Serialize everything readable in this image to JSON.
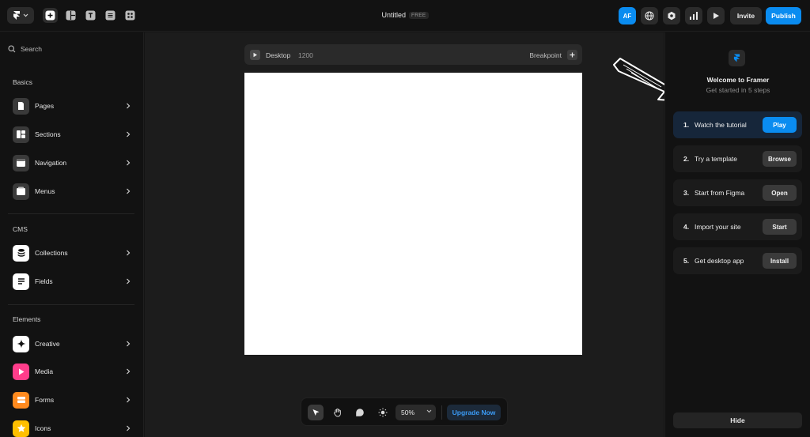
{
  "topbar": {
    "title": "Untitled",
    "plan_badge": "FREE",
    "avatar_initials": "AF",
    "invite_label": "Invite",
    "publish_label": "Publish"
  },
  "sidebar": {
    "search_placeholder": "Search",
    "sections": [
      {
        "label": "Basics",
        "items": [
          {
            "label": "Pages",
            "icon": "page-icon"
          },
          {
            "label": "Sections",
            "icon": "sections-icon"
          },
          {
            "label": "Navigation",
            "icon": "navigation-icon"
          },
          {
            "label": "Menus",
            "icon": "menus-icon"
          }
        ]
      },
      {
        "label": "CMS",
        "items": [
          {
            "label": "Collections",
            "icon": "database-icon"
          },
          {
            "label": "Fields",
            "icon": "fields-icon"
          }
        ]
      },
      {
        "label": "Elements",
        "items": [
          {
            "label": "Creative",
            "icon": "sparkle-icon",
            "color": "#ffffff"
          },
          {
            "label": "Media",
            "icon": "play-icon",
            "color": "#ff3d8b"
          },
          {
            "label": "Forms",
            "icon": "forms-icon",
            "color": "#ff8a1e"
          },
          {
            "label": "Icons",
            "icon": "star-icon",
            "color": "#ffbf00"
          }
        ]
      }
    ]
  },
  "canvas": {
    "frame_name": "Desktop",
    "frame_width": "1200",
    "breakpoint_label": "Breakpoint",
    "zoom": "50%",
    "upgrade_label": "Upgrade Now"
  },
  "welcome": {
    "title": "Welcome to Framer",
    "subtitle": "Get started in 5 steps",
    "steps": [
      {
        "num": "1.",
        "label": "Watch the tutorial",
        "action": "Play",
        "primary": true
      },
      {
        "num": "2.",
        "label": "Try a template",
        "action": "Browse",
        "primary": false
      },
      {
        "num": "3.",
        "label": "Start from Figma",
        "action": "Open",
        "primary": false
      },
      {
        "num": "4.",
        "label": "Import your site",
        "action": "Start",
        "primary": false
      },
      {
        "num": "5.",
        "label": "Get desktop app",
        "action": "Install",
        "primary": false
      }
    ],
    "hide_label": "Hide"
  },
  "colors": {
    "accent": "#0a8cf0",
    "background": "#141414",
    "canvas": "#1c1c1c"
  }
}
